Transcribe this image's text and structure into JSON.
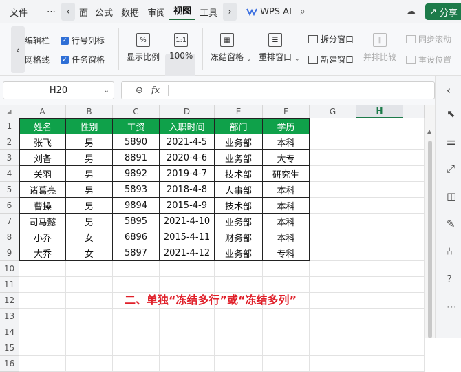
{
  "menubar": {
    "file": "文件",
    "more": "⋯",
    "items": [
      "面",
      "公式",
      "数据",
      "审阅",
      "视图",
      "工具"
    ],
    "active_index": 4,
    "wps_ai": "WPS AI",
    "share": "分享"
  },
  "ribbon": {
    "checkbox_edit_bar": "编辑栏",
    "checkbox_row_col_labels": "行号列标",
    "checkbox_gridlines": "网格线",
    "checkbox_task_pane": "任务窗格",
    "display_ratio": "显示比例",
    "zoom_level": "100%",
    "freeze_panes": "冻结窗格",
    "arrange_windows": "重排窗口",
    "split_window": "拆分窗口",
    "new_window": "新建窗口",
    "side_by_side": "并排比较",
    "sync_scroll": "同步滚动",
    "reset_position": "重设位置"
  },
  "formula_bar": {
    "name_box": "H20",
    "fx_label": "fx",
    "value": ""
  },
  "sheet": {
    "columns": [
      "A",
      "B",
      "C",
      "D",
      "E",
      "F",
      "G",
      "H"
    ],
    "selected_column": "H",
    "row_numbers": [
      "1",
      "2",
      "3",
      "4",
      "5",
      "6",
      "7",
      "8",
      "9",
      "10",
      "11",
      "12",
      "13",
      "14",
      "15",
      "16"
    ],
    "header_color": "#0fa14a",
    "table_headers": [
      "姓名",
      "性别",
      "工资",
      "入职时间",
      "部门",
      "学历"
    ],
    "table_rows": [
      [
        "张飞",
        "男",
        "5890",
        "2021-4-5",
        "业务部",
        "本科"
      ],
      [
        "刘备",
        "男",
        "8891",
        "2020-4-6",
        "业务部",
        "大专"
      ],
      [
        "关羽",
        "男",
        "9892",
        "2019-4-7",
        "技术部",
        "研究生"
      ],
      [
        "诸葛亮",
        "男",
        "5893",
        "2018-4-8",
        "人事部",
        "本科"
      ],
      [
        "曹操",
        "男",
        "9894",
        "2015-4-9",
        "技术部",
        "本科"
      ],
      [
        "司马懿",
        "男",
        "5895",
        "2021-4-10",
        "业务部",
        "本科"
      ],
      [
        "小乔",
        "女",
        "6896",
        "2015-4-11",
        "财务部",
        "本科"
      ],
      [
        "大乔",
        "女",
        "5897",
        "2021-4-12",
        "业务部",
        "专科"
      ]
    ],
    "caption": "二、单独“冻结多行”或“冻结多列”",
    "caption_color": "#e0202a"
  }
}
